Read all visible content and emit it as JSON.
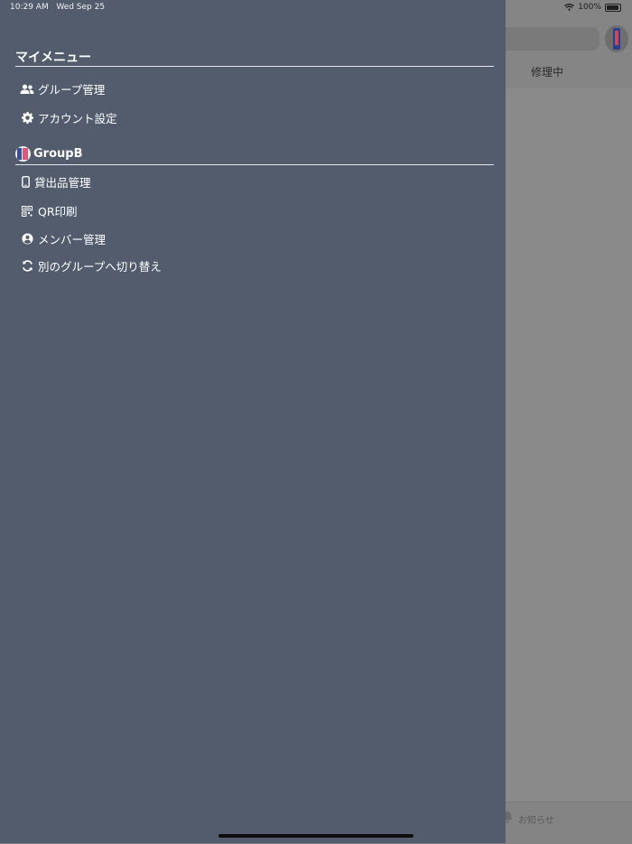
{
  "status_bar": {
    "time": "10:29 AM",
    "date": "Wed Sep 25",
    "battery": "100%"
  },
  "background": {
    "tab_label": "修理中",
    "notice_label": "お知らせ"
  },
  "drawer": {
    "my_menu": {
      "title": "マイメニュー",
      "items": [
        {
          "label": "グループ管理",
          "icon": "users-icon"
        },
        {
          "label": "アカウント設定",
          "icon": "gear-icon"
        }
      ]
    },
    "group": {
      "name": "GroupB",
      "items": [
        {
          "label": "貸出品管理",
          "icon": "phone-icon"
        },
        {
          "label": "QR印刷",
          "icon": "qr-icon"
        },
        {
          "label": "メンバー管理",
          "icon": "user-circle-icon"
        },
        {
          "label": "別のグループへ切り替え",
          "icon": "refresh-icon"
        }
      ]
    }
  },
  "colors": {
    "drawer_bg": "#525c6c",
    "text": "#ffffff"
  }
}
